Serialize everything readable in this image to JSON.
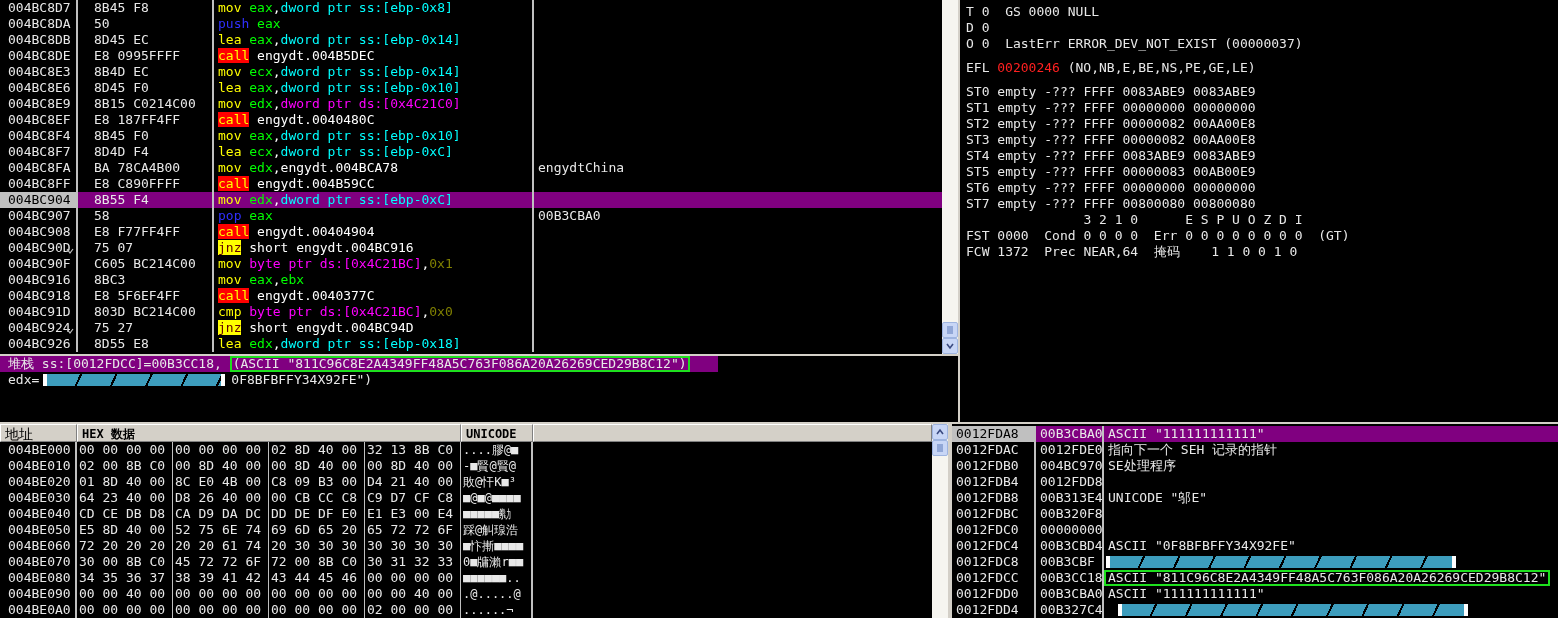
{
  "disassembly": {
    "rows": [
      {
        "address": "004BC8D7",
        "bytes": "8B45 F8",
        "mnemonic": {
          "text": "mov",
          "kind": "op"
        },
        "operands": [
          {
            "text": "eax",
            "kind": "reg"
          },
          {
            "text": ",",
            "kind": "plain"
          },
          {
            "text": "dword ptr ss:[ebp-0x8]",
            "kind": "ss"
          }
        ],
        "selected": false,
        "jump": false
      },
      {
        "address": "004BC8DA",
        "bytes": "50",
        "mnemonic": {
          "text": "push",
          "kind": "stack"
        },
        "operands": [
          {
            "text": "eax",
            "kind": "reg"
          }
        ],
        "selected": false,
        "jump": false
      },
      {
        "address": "004BC8DB",
        "bytes": "8D45 EC",
        "mnemonic": {
          "text": "lea",
          "kind": "op"
        },
        "operands": [
          {
            "text": "eax",
            "kind": "reg"
          },
          {
            "text": ",",
            "kind": "plain"
          },
          {
            "text": "dword ptr ss:[ebp-0x14]",
            "kind": "ss"
          }
        ],
        "selected": false,
        "jump": false
      },
      {
        "address": "004BC8DE",
        "bytes": "E8 0995FFFF",
        "mnemonic": {
          "text": "call",
          "kind": "call"
        },
        "operands": [
          {
            "text": "engydt.004B5DEC",
            "kind": "plain"
          }
        ],
        "selected": false,
        "jump": false
      },
      {
        "address": "004BC8E3",
        "bytes": "8B4D EC",
        "mnemonic": {
          "text": "mov",
          "kind": "op"
        },
        "operands": [
          {
            "text": "ecx",
            "kind": "reg"
          },
          {
            "text": ",",
            "kind": "plain"
          },
          {
            "text": "dword ptr ss:[ebp-0x14]",
            "kind": "ss"
          }
        ],
        "selected": false,
        "jump": false
      },
      {
        "address": "004BC8E6",
        "bytes": "8D45 F0",
        "mnemonic": {
          "text": "lea",
          "kind": "op"
        },
        "operands": [
          {
            "text": "eax",
            "kind": "reg"
          },
          {
            "text": ",",
            "kind": "plain"
          },
          {
            "text": "dword ptr ss:[ebp-0x10]",
            "kind": "ss"
          }
        ],
        "selected": false,
        "jump": false
      },
      {
        "address": "004BC8E9",
        "bytes": "8B15 C0214C00",
        "mnemonic": {
          "text": "mov",
          "kind": "op"
        },
        "operands": [
          {
            "text": "edx",
            "kind": "reg"
          },
          {
            "text": ",",
            "kind": "plain"
          },
          {
            "text": "dword ptr ds:[0x4C21C0]",
            "kind": "ds"
          }
        ],
        "selected": false,
        "jump": false
      },
      {
        "address": "004BC8EF",
        "bytes": "E8 187FF4FF",
        "mnemonic": {
          "text": "call",
          "kind": "call"
        },
        "operands": [
          {
            "text": "engydt.0040480C",
            "kind": "plain"
          }
        ],
        "selected": false,
        "jump": false
      },
      {
        "address": "004BC8F4",
        "bytes": "8B45 F0",
        "mnemonic": {
          "text": "mov",
          "kind": "op"
        },
        "operands": [
          {
            "text": "eax",
            "kind": "reg"
          },
          {
            "text": ",",
            "kind": "plain"
          },
          {
            "text": "dword ptr ss:[ebp-0x10]",
            "kind": "ss"
          }
        ],
        "selected": false,
        "jump": false
      },
      {
        "address": "004BC8F7",
        "bytes": "8D4D F4",
        "mnemonic": {
          "text": "lea",
          "kind": "op"
        },
        "operands": [
          {
            "text": "ecx",
            "kind": "reg"
          },
          {
            "text": ",",
            "kind": "plain"
          },
          {
            "text": "dword ptr ss:[ebp-0xC]",
            "kind": "ss"
          }
        ],
        "selected": false,
        "jump": false
      },
      {
        "address": "004BC8FA",
        "bytes": "BA 78CA4B00",
        "mnemonic": {
          "text": "mov",
          "kind": "op"
        },
        "operands": [
          {
            "text": "edx",
            "kind": "reg"
          },
          {
            "text": ",engydt.004BCA78",
            "kind": "plain"
          }
        ],
        "comment": "engydtChina",
        "selected": false,
        "jump": false
      },
      {
        "address": "004BC8FF",
        "bytes": "E8 C890FFFF",
        "mnemonic": {
          "text": "call",
          "kind": "call"
        },
        "operands": [
          {
            "text": "engydt.004B59CC",
            "kind": "plain"
          }
        ],
        "selected": false,
        "jump": false
      },
      {
        "address": "004BC904",
        "bytes": "8B55 F4",
        "mnemonic": {
          "text": "mov",
          "kind": "op"
        },
        "operands": [
          {
            "text": "edx",
            "kind": "reg"
          },
          {
            "text": ",",
            "kind": "plain"
          },
          {
            "text": "dword ptr ss:[ebp-0xC]",
            "kind": "ss"
          }
        ],
        "selected": true,
        "jump": false
      },
      {
        "address": "004BC907",
        "bytes": "58",
        "mnemonic": {
          "text": "pop",
          "kind": "stack"
        },
        "operands": [
          {
            "text": "eax",
            "kind": "reg"
          }
        ],
        "comment": "00B3CBA0",
        "selected": false,
        "jump": false
      },
      {
        "address": "004BC908",
        "bytes": "E8 F77FF4FF",
        "mnemonic": {
          "text": "call",
          "kind": "call"
        },
        "operands": [
          {
            "text": "engydt.00404904",
            "kind": "plain"
          }
        ],
        "selected": false,
        "jump": false
      },
      {
        "address": "004BC90D",
        "bytes": "75 07",
        "mnemonic": {
          "text": "jnz",
          "kind": "jcc"
        },
        "operands": [
          {
            "text": "short engydt.004BC916",
            "kind": "plain"
          }
        ],
        "selected": false,
        "jump": true
      },
      {
        "address": "004BC90F",
        "bytes": "C605 BC214C00",
        "mnemonic": {
          "text": "mov",
          "kind": "op"
        },
        "operands": [
          {
            "text": "byte ptr ds:[0x4C21BC]",
            "kind": "ds"
          },
          {
            "text": ",",
            "kind": "plain"
          },
          {
            "text": "0x1",
            "kind": "imm"
          }
        ],
        "selected": false,
        "jump": false
      },
      {
        "address": "004BC916",
        "bytes": "8BC3",
        "mnemonic": {
          "text": "mov",
          "kind": "op"
        },
        "operands": [
          {
            "text": "eax",
            "kind": "reg"
          },
          {
            "text": ",",
            "kind": "plain"
          },
          {
            "text": "ebx",
            "kind": "reg"
          }
        ],
        "selected": false,
        "jump": false
      },
      {
        "address": "004BC918",
        "bytes": "E8 5F6EF4FF",
        "mnemonic": {
          "text": "call",
          "kind": "call"
        },
        "operands": [
          {
            "text": "engydt.0040377C",
            "kind": "plain"
          }
        ],
        "selected": false,
        "jump": false
      },
      {
        "address": "004BC91D",
        "bytes": "803D BC214C00",
        "mnemonic": {
          "text": "cmp",
          "kind": "op"
        },
        "operands": [
          {
            "text": "byte ptr ds:[0x4C21BC]",
            "kind": "ds"
          },
          {
            "text": ",",
            "kind": "plain"
          },
          {
            "text": "0x0",
            "kind": "imm"
          }
        ],
        "selected": false,
        "jump": false
      },
      {
        "address": "004BC924",
        "bytes": "75 27",
        "mnemonic": {
          "text": "jnz",
          "kind": "jcc"
        },
        "operands": [
          {
            "text": "short engydt.004BC94D",
            "kind": "plain"
          }
        ],
        "selected": false,
        "jump": true
      },
      {
        "address": "004BC926",
        "bytes": "8D55 E8",
        "mnemonic": {
          "text": "lea",
          "kind": "op"
        },
        "operands": [
          {
            "text": "edx",
            "kind": "reg"
          },
          {
            "text": ",",
            "kind": "plain"
          },
          {
            "text": "dword ptr ss:[ebp-0x18]",
            "kind": "ss"
          }
        ],
        "selected": false,
        "jump": false
      }
    ]
  },
  "info": {
    "stack_text": "堆栈 ss:[0012FDCC]=00B3CC18,",
    "stack_boxed": "(ASCII \"811C96C8E2A4349FF48A5C763F086A20A26269CED29B8C12\")",
    "edx_label": "edx=",
    "edx_redacted": true,
    "edx_tail": "0F8BFBFFY34X92FE\")"
  },
  "registers": {
    "top_lines": [
      "T 0  GS 0000 NULL",
      "D 0",
      "O 0  LastErr ERROR_DEV_NOT_EXIST (00000037)"
    ],
    "efl": {
      "label": "EFL",
      "value": "00200246",
      "changed": true,
      "flags": "(NO,NB,E,BE,NS,PE,GE,LE)"
    },
    "fpu_lines": [
      "ST0 empty -??? FFFF 0083ABE9 0083ABE9",
      "ST1 empty -??? FFFF 00000000 00000000",
      "ST2 empty -??? FFFF 00000082 00AA00E8",
      "ST3 empty -??? FFFF 00000082 00AA00E8",
      "ST4 empty -??? FFFF 0083ABE9 0083ABE9",
      "ST5 empty -??? FFFF 00000083 00AB00E9",
      "ST6 empty -??? FFFF 00000000 00000000",
      "ST7 empty -??? FFFF 00800080 00800080",
      "               3 2 1 0      E S P U O Z D I",
      "FST 0000  Cond 0 0 0 0  Err 0 0 0 0 0 0 0 0  (GT)",
      "FCW 1372  Prec NEAR,64  掩码    1 1 0 0 1 0"
    ]
  },
  "dump": {
    "columns": [
      "地址",
      "HEX 数据",
      "UNICODE"
    ],
    "rows": [
      {
        "address": "004BE000",
        "groups": [
          "00 00 00 00",
          "00 00 00 00",
          "02 8D 40 00",
          "32 13 8B C0"
        ],
        "text": "....膠@■"
      },
      {
        "address": "004BE010",
        "groups": [
          "02 00 8B C0",
          "00 8D 40 00",
          "00 8D 40 00",
          "00 8D 40 00"
        ],
        "text": "-■賢@賢@"
      },
      {
        "address": "004BE020",
        "groups": [
          "01 8D 40 00",
          "8C E0 4B 00",
          "C8 09 B3 00",
          "D4 21 40 00"
        ],
        "text": "敗@忓K■³"
      },
      {
        "address": "004BE030",
        "groups": [
          "64 23 40 00",
          "D8 26 40 00",
          "00 CB CC C8",
          "C9 D7 CF C8"
        ],
        "text": "■@■@■■■■"
      },
      {
        "address": "004BE040",
        "groups": [
          "CD CE DB D8",
          "CA D9 DA DC",
          "DD DE DF E0",
          "E1 E3 00 E4"
        ],
        "text": "■■■■■勬"
      },
      {
        "address": "004BE050",
        "groups": [
          "E5 8D 40 00",
          "52 75 6E 74",
          "69 6D 65 20",
          "65 72 72 6F"
        ],
        "text": "踩@觓瑔浩"
      },
      {
        "address": "004BE060",
        "groups": [
          "72 20 20 20",
          "20 20 61 74",
          "20 30 30 30",
          "30 30 30 30"
        ],
        "text": "■忭摲■■■■"
      },
      {
        "address": "004BE070",
        "groups": [
          "30 00 8B C0",
          "45 72 72 6F",
          "72 00 8B C0",
          "30 31 32 33"
        ],
        "text": "0■牗瀨r■■"
      },
      {
        "address": "004BE080",
        "groups": [
          "34 35 36 37",
          "38 39 41 42",
          "43 44 45 46",
          "00 00 00 00"
        ],
        "text": "■■■■■■.."
      },
      {
        "address": "004BE090",
        "groups": [
          "00 00 40 00",
          "00 00 00 00",
          "00 00 00 00",
          "00 00 40 00"
        ],
        "text": ".@.....@"
      },
      {
        "address": "004BE0A0",
        "groups": [
          "00 00 00 00",
          "00 00 00 00",
          "00 00 00 00",
          "02 00 00 00"
        ],
        "text": "......¬"
      }
    ]
  },
  "stack": {
    "rows": [
      {
        "address": "0012FDA8",
        "value": "00B3CBA0",
        "comment": "ASCII \"111111111111\"",
        "selected": true,
        "redacted": false,
        "boxed": false
      },
      {
        "address": "0012FDAC",
        "value": "0012FDE0",
        "comment": "指向下一个 SEH 记录的指针",
        "selected": false,
        "redacted": false,
        "boxed": false
      },
      {
        "address": "0012FDB0",
        "value": "004BC970",
        "comment": "SE处理程序",
        "selected": false,
        "redacted": false,
        "boxed": false
      },
      {
        "address": "0012FDB4",
        "value": "0012FDD8",
        "selected": false,
        "redacted": false,
        "boxed": false
      },
      {
        "address": "0012FDB8",
        "value": "00B313E4",
        "comment": "UNICODE \"邬E\"",
        "selected": false,
        "redacted": false,
        "boxed": false
      },
      {
        "address": "0012FDBC",
        "value": "00B320F8",
        "selected": false,
        "redacted": false,
        "boxed": false
      },
      {
        "address": "0012FDC0",
        "value": "00000000",
        "selected": false,
        "redacted": false,
        "boxed": false
      },
      {
        "address": "0012FDC4",
        "value": "00B3CBD4",
        "comment": "ASCII \"0F8BFBFFY34X92FE\"",
        "selected": false,
        "redacted": false,
        "boxed": false
      },
      {
        "address": "0012FDC8",
        "value": "00B3CBF",
        "selected": false,
        "redacted": true,
        "boxed": false
      },
      {
        "address": "0012FDCC",
        "value": "00B3CC18",
        "comment": "ASCII \"811C96C8E2A4349FF48A5C763F086A20A26269CED29B8C12\"",
        "selected": false,
        "redacted": false,
        "boxed": true
      },
      {
        "address": "0012FDD0",
        "value": "00B3CBA0",
        "comment": "ASCII \"111111111111\"",
        "selected": false,
        "redacted": false,
        "boxed": false
      },
      {
        "address": "0012FDD4",
        "value": "00B327C4",
        "selected": false,
        "redacted": true,
        "boxed": false
      }
    ]
  }
}
